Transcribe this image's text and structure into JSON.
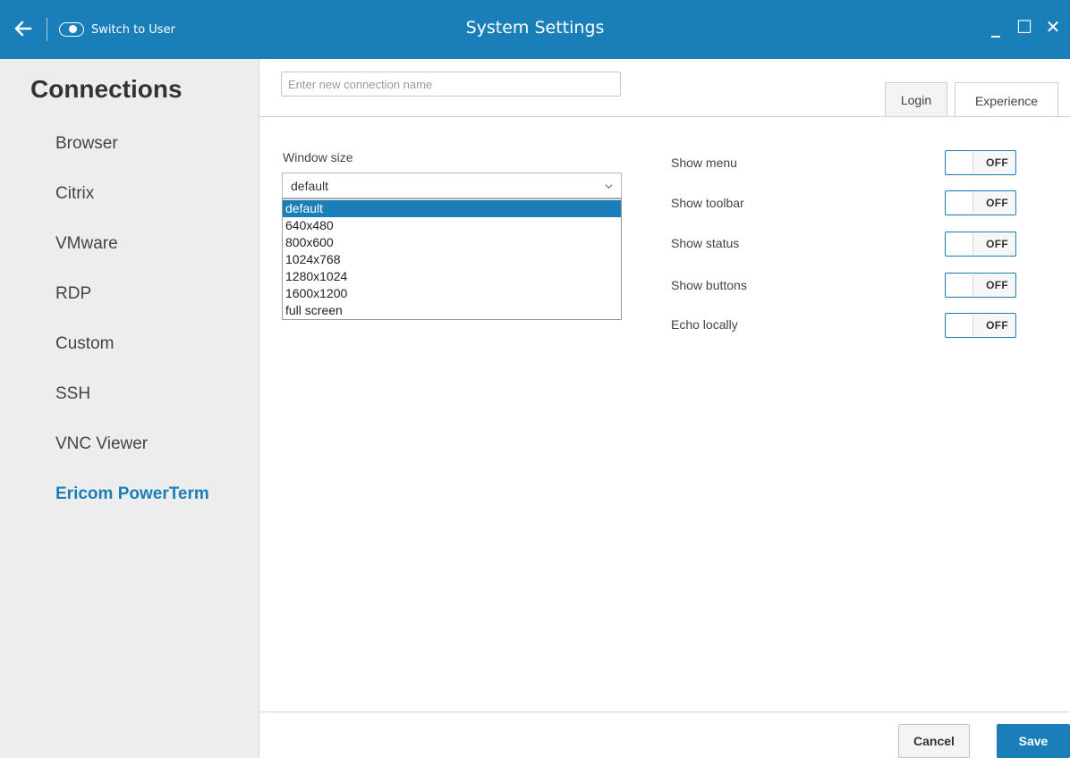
{
  "titlebar": {
    "switch_label": "Switch to User",
    "title": "System Settings",
    "controls": {
      "minimize": "_",
      "maximize": "☐",
      "close": "✕"
    }
  },
  "sidebar": {
    "title": "Connections",
    "items": [
      {
        "label": "Browser"
      },
      {
        "label": "Citrix"
      },
      {
        "label": "VMware"
      },
      {
        "label": "RDP"
      },
      {
        "label": "Custom"
      },
      {
        "label": "SSH"
      },
      {
        "label": "VNC Viewer"
      },
      {
        "label": "Ericom PowerTerm",
        "active": true
      }
    ]
  },
  "main": {
    "connection_name": {
      "value": "",
      "placeholder": "Enter new connection name"
    },
    "tabs": [
      {
        "label": "Login",
        "active": false
      },
      {
        "label": "Experience",
        "active": true
      }
    ],
    "window_size": {
      "label": "Window size",
      "selected": "default",
      "options": [
        "default",
        "640x480",
        "800x600",
        "1024x768",
        "1280x1024",
        "1600x1200",
        "full screen"
      ]
    },
    "toggles": [
      {
        "label": "Show menu",
        "state": "OFF"
      },
      {
        "label": "Show toolbar",
        "state": "OFF"
      },
      {
        "label": "Show status",
        "state": "OFF"
      },
      {
        "label": "Show buttons",
        "state": "OFF"
      },
      {
        "label": "Echo locally",
        "state": "OFF"
      }
    ]
  },
  "footer": {
    "cancel_label": "Cancel",
    "save_label": "Save"
  },
  "colors": {
    "accent": "#1a7fb8",
    "sidebar_bg": "#ededed"
  }
}
